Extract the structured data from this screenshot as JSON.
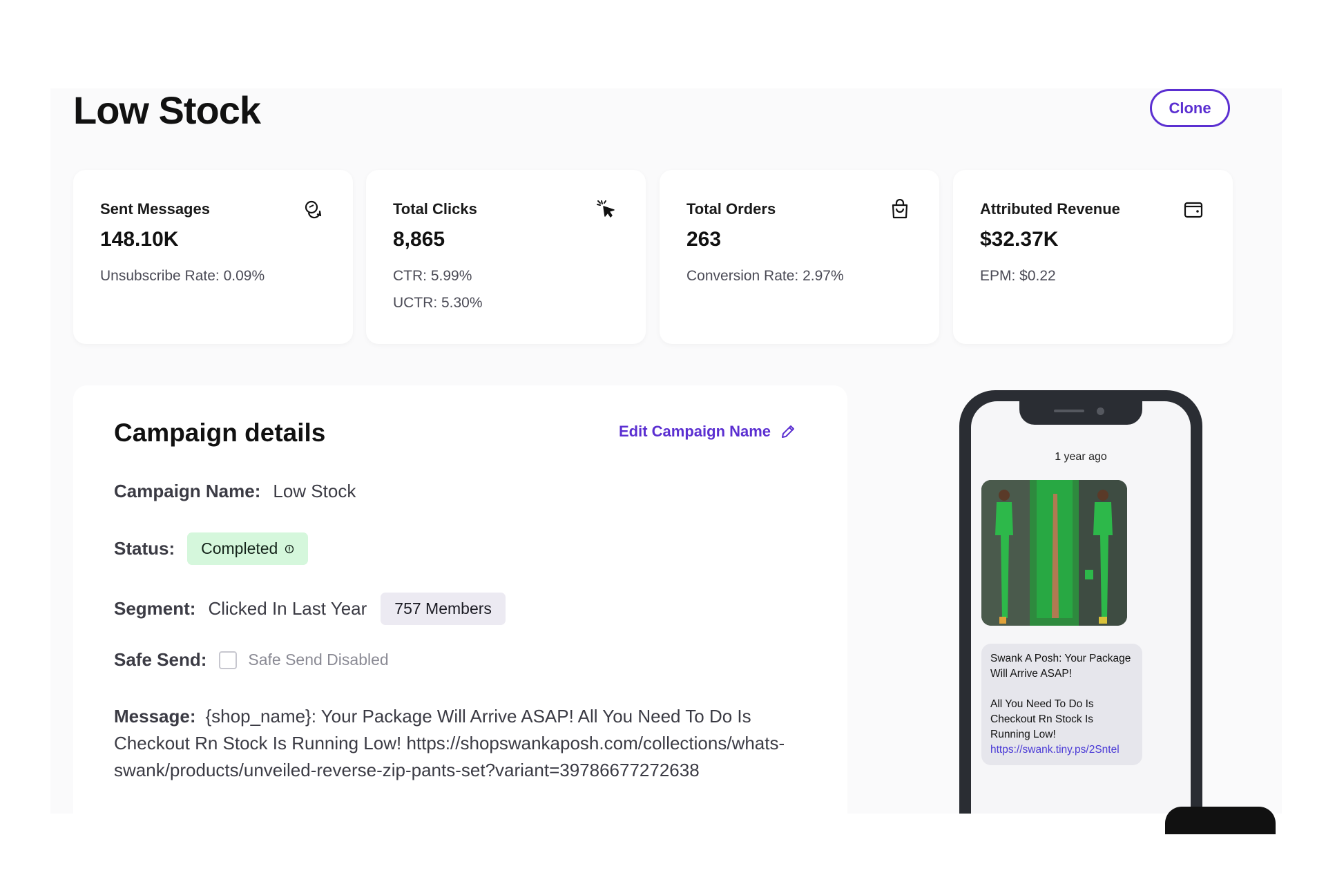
{
  "header": {
    "title": "Low Stock",
    "clone_label": "Clone"
  },
  "stats": [
    {
      "title": "Sent Messages",
      "value": "148.10K",
      "sub1": "Unsubscribe Rate: 0.09%",
      "sub2": "",
      "icon": "chat-bubbles-icon"
    },
    {
      "title": "Total Clicks",
      "value": "8,865",
      "sub1": "CTR: 5.99%",
      "sub2": "UCTR: 5.30%",
      "icon": "cursor-click-icon"
    },
    {
      "title": "Total Orders",
      "value": "263",
      "sub1": "Conversion Rate: 2.97%",
      "sub2": "",
      "icon": "shopping-bag-icon"
    },
    {
      "title": "Attributed Revenue",
      "value": "$32.37K",
      "sub1": "EPM: $0.22",
      "sub2": "",
      "icon": "wallet-icon"
    }
  ],
  "details": {
    "heading": "Campaign details",
    "edit_label": "Edit Campaign Name",
    "campaign_name_label": "Campaign Name:",
    "campaign_name": "Low Stock",
    "status_label": "Status:",
    "status": "Completed",
    "segment_label": "Segment:",
    "segment": "Clicked In Last Year",
    "members": "757 Members",
    "safe_send_label": "Safe Send:",
    "safe_send_text": "Safe Send Disabled",
    "safe_send_checked": false,
    "message_label": "Message:",
    "message": "{shop_name}: Your Package Will Arrive ASAP! All You Need To Do Is Checkout Rn Stock Is Running Low! https://shopswankaposh.com/collections/whats-swank/products/unveiled-reverse-zip-pants-set?variant=39786677272638"
  },
  "preview": {
    "timestamp": "1 year ago",
    "bubble_text": "Swank A Posh: Your Package Will Arrive ASAP!\n\nAll You Need To Do Is Checkout Rn Stock Is Running Low!",
    "bubble_link": "https://swank.tiny.ps/2Sntel"
  },
  "colors": {
    "accent": "#5b2fd1",
    "status_completed_bg": "#d5f7dc",
    "members_badge_bg": "#eceaf2"
  }
}
